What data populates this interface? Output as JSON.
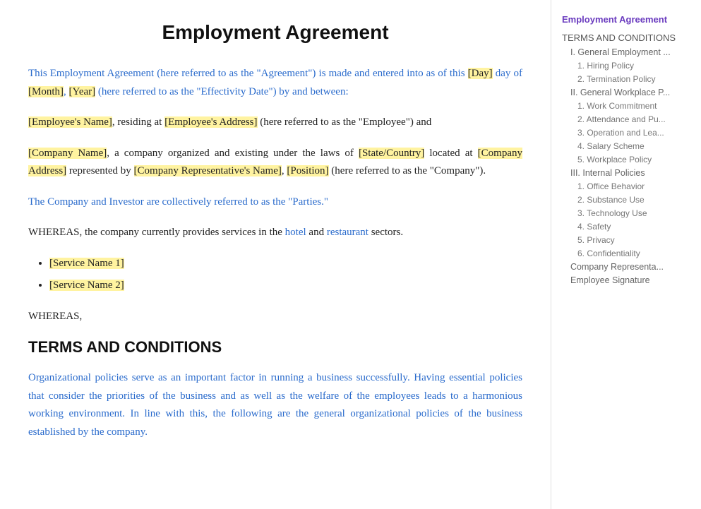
{
  "document": {
    "title": "Employment Agreement",
    "intro_paragraph_1": "This Employment Agreement (here referred to as the \"Agreement\") is made and entered into as of this ",
    "intro_day": "[Day]",
    "intro_mid1": " day of ",
    "intro_month": "[Month]",
    "intro_comma": ", ",
    "intro_year": "[Year]",
    "intro_end1": " (here referred to as the \"Effectivity Date\") by and between:",
    "intro_paragraph_2_start": "",
    "employee_name": "[Employee's Name]",
    "intro_p2_mid": ", residing at ",
    "employee_address": "[Employee's Address]",
    "intro_p2_end": " (here referred to as the \"Employee\") and",
    "company_name": "[Company Name]",
    "intro_p3_mid1": ", a company organized and existing under the laws of ",
    "state_country": "[State/Country]",
    "intro_p3_mid2": " located at ",
    "company_address": "[Company Address]",
    "intro_p3_mid3": " represented by ",
    "company_rep": "[Company Representative's Name]",
    "intro_p3_comma": ", ",
    "position": "[Position]",
    "intro_p3_end": " (here referred to as the \"Company\").",
    "parties_text": "The Company and Investor are collectively referred to as the \"Parties.\"",
    "whereas_text": "WHEREAS, the company currently provides services in the hotel and restaurant sectors.",
    "service_1": "[Service Name 1]",
    "service_2": "[Service Name 2]",
    "whereas_2": "WHEREAS,",
    "terms_heading": "TERMS AND CONDITIONS",
    "terms_intro": "Organizational policies serve as an important factor in running a business successfully. Having essential policies that consider the priorities of the business and as well as the welfare of the employees leads to a harmonious working environment. In line with this, the following are the general organizational policies of the business established by the company."
  },
  "toc": {
    "title": "Employment Agreement",
    "items": [
      {
        "label": "TERMS AND CONDITIONS",
        "level": "section",
        "children": [
          {
            "label": "I. General Employment ...",
            "level": "subsection",
            "children": [
              {
                "label": "1. Hiring Policy",
                "level": "item"
              },
              {
                "label": "2. Termination Policy",
                "level": "item"
              }
            ]
          },
          {
            "label": "II. General Workplace P...",
            "level": "subsection",
            "children": [
              {
                "label": "1. Work Commitment",
                "level": "item"
              },
              {
                "label": "2. Attendance and Pu...",
                "level": "item"
              },
              {
                "label": "3.  Operation and Lea...",
                "level": "item"
              },
              {
                "label": "4. Salary Scheme",
                "level": "item"
              },
              {
                "label": "5.  Workplace Policy",
                "level": "item"
              }
            ]
          },
          {
            "label": "III. Internal Policies",
            "level": "subsection",
            "children": [
              {
                "label": "1. Office Behavior",
                "level": "item"
              },
              {
                "label": "2. Substance Use",
                "level": "item"
              },
              {
                "label": "3. Technology Use",
                "level": "item"
              },
              {
                "label": "4. Safety",
                "level": "item"
              },
              {
                "label": "5. Privacy",
                "level": "item"
              },
              {
                "label": "6. Confidentiality",
                "level": "item"
              }
            ]
          },
          {
            "label": "Company Representa...",
            "level": "subsection",
            "children": []
          },
          {
            "label": "Employee Signature",
            "level": "subsection",
            "children": []
          }
        ]
      }
    ]
  }
}
